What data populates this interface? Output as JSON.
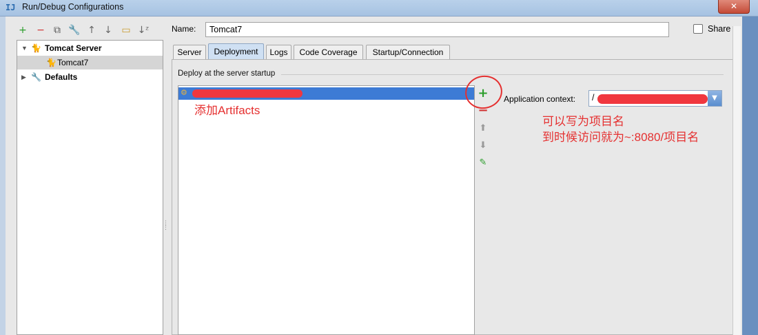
{
  "window": {
    "title": "Run/Debug Configurations",
    "app_icon": "IJ",
    "close_glyph": "✕"
  },
  "toolbar": {
    "icons": [
      {
        "name": "add-icon",
        "glyph": "+",
        "color": "#2a9d2a"
      },
      {
        "name": "remove-icon",
        "glyph": "−",
        "color": "#d03030"
      },
      {
        "name": "copy-icon",
        "glyph": "⧉",
        "color": "#555555"
      },
      {
        "name": "wrench-icon",
        "glyph": "🔧",
        "color": "#666666"
      },
      {
        "name": "move-up-icon",
        "glyph": "↑",
        "color": "#666666"
      },
      {
        "name": "move-down-icon",
        "glyph": "↓",
        "color": "#666666"
      },
      {
        "name": "folder-icon",
        "glyph": "▭",
        "color": "#c99a2e"
      },
      {
        "name": "sort-icon",
        "glyph": "↓ᶻ",
        "color": "#666666"
      }
    ]
  },
  "tree": {
    "items": [
      {
        "label": "Tomcat Server",
        "bold": true,
        "expanded": true,
        "level": 0,
        "icon": "tomcat-icon"
      },
      {
        "label": "Tomcat7",
        "bold": false,
        "selected": true,
        "level": 1,
        "icon": "tomcat-icon"
      },
      {
        "label": "Defaults",
        "bold": true,
        "expanded": false,
        "level": 0,
        "icon": "wrench-icon"
      }
    ]
  },
  "form": {
    "name_label": "Name:",
    "name_value": "Tomcat7",
    "share_label": "Share",
    "share_checked": false
  },
  "tabs": [
    {
      "label": "Server",
      "active": false
    },
    {
      "label": "Deployment",
      "active": true
    },
    {
      "label": "Logs",
      "active": false
    },
    {
      "label": "Code Coverage",
      "active": false
    },
    {
      "label": "Startup/Connection",
      "active": false
    }
  ],
  "deployment": {
    "section_title": "Deploy at the server startup",
    "context_label": "Application context:",
    "context_value": "/",
    "side_buttons": [
      {
        "name": "add-artifact-icon",
        "glyph": "+",
        "color": "#2a9d2a"
      },
      {
        "name": "remove-artifact-icon",
        "glyph": "−",
        "color": "#d03030"
      },
      {
        "name": "move-up-icon",
        "glyph": "⬆",
        "color": "#999999"
      },
      {
        "name": "move-down-icon",
        "glyph": "⬇",
        "color": "#999999"
      },
      {
        "name": "edit-icon",
        "glyph": "✎",
        "color": "#2a9d2a"
      }
    ]
  },
  "annotations": {
    "add_artifacts": "添加Artifacts",
    "context_hint_1": "可以写为项目名",
    "context_hint_2": "到时候访问就为~:8080/项目名",
    "color": "#e53030"
  }
}
